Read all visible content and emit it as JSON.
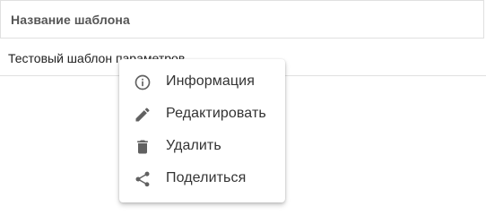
{
  "table": {
    "column_header": "Название шаблона",
    "rows": [
      {
        "name": "Тестовый шаблон параметров"
      }
    ]
  },
  "context_menu": {
    "items": [
      {
        "label": "Информация",
        "icon": "info-icon"
      },
      {
        "label": "Редактировать",
        "icon": "pencil-icon"
      },
      {
        "label": "Удалить",
        "icon": "trash-icon"
      },
      {
        "label": "Поделиться",
        "icon": "share-icon"
      }
    ]
  },
  "colors": {
    "icon": "#616161",
    "text": "#333333",
    "border": "#e0e0e0"
  }
}
